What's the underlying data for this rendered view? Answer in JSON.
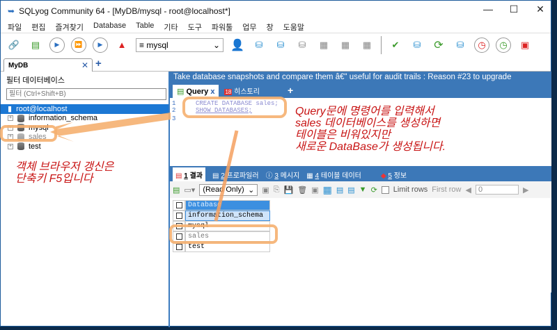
{
  "window": {
    "title": "SQLyog Community 64 - [MyDB/mysql - root@localhost*]",
    "minimize": "—",
    "maximize": "☐",
    "close": "✕"
  },
  "menu": [
    "파일",
    "편집",
    "즐겨찾기",
    "Database",
    "Table",
    "기타",
    "도구",
    "파워툴",
    "업무",
    "창",
    "도움말"
  ],
  "toolbar": {
    "db_select": "mysql"
  },
  "doc_tab": {
    "label": "MyDB",
    "close": "✕",
    "add": "+"
  },
  "left": {
    "filter_label": "필터 데이터베이스",
    "filter_placeholder": "필터 (Ctrl+Shift+B)",
    "root": "root@localhost",
    "databases": [
      "information_schema",
      "mysql",
      "sales",
      "test"
    ]
  },
  "banner": "Take database snapshots and compare them â€\" useful for audit trails : Reason #23 to upgrade",
  "query_tabs": {
    "query": "Query",
    "close": "x",
    "history_icon_num": "18",
    "history": "히스토리",
    "add": "+"
  },
  "editor": {
    "line_numbers": [
      "1",
      "2",
      "3"
    ],
    "lines": [
      "CREATE DATABASE sales;",
      "SHOW DATABASES;",
      ""
    ]
  },
  "result_tabs": [
    {
      "num": "1",
      "label": "결과"
    },
    {
      "num": "2",
      "label": "프로파일러"
    },
    {
      "num": "3",
      "label": "메시지"
    },
    {
      "num": "4",
      "label": "테이블 데이터"
    },
    {
      "num": "5",
      "label": "정보"
    }
  ],
  "result_toolbar": {
    "mode": "(Read Only)",
    "limit_rows": "Limit rows",
    "first_row": "First row",
    "first_row_value": "0"
  },
  "grid": {
    "header": "Database",
    "rows": [
      "information_schema",
      "mysql",
      "sales",
      "test"
    ]
  },
  "annotations": {
    "query_note": "Query문에 명령어를 입력해서\nsales 데이터베이스를 생성하면\n테이블은 비워있지만\n새로운 DataBase가 생성됩니다.",
    "refresh_note": "객체 브라우저 갱신은\n단축키 F5입니다"
  }
}
